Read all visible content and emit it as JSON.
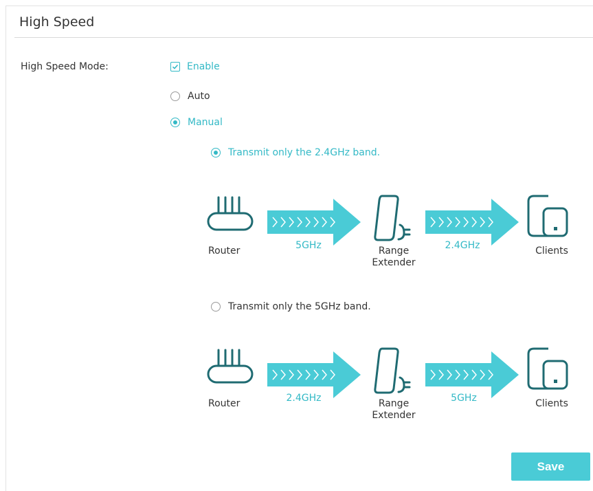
{
  "section": {
    "title": "High Speed"
  },
  "mode": {
    "label": "High Speed Mode:",
    "enable_label": "Enable",
    "enabled": true,
    "auto_label": "Auto",
    "manual_label": "Manual",
    "selected": "Manual"
  },
  "bands": [
    {
      "option_label": "Transmit only the 2.4GHz band.",
      "selected": true,
      "router_label": "Router",
      "link1_label": "5GHz",
      "extender_label_line1": "Range",
      "extender_label_line2": "Extender",
      "link2_label": "2.4GHz",
      "clients_label": "Clients"
    },
    {
      "option_label": "Transmit only the 5GHz band.",
      "selected": false,
      "router_label": "Router",
      "link1_label": "2.4GHz",
      "extender_label_line1": "Range",
      "extender_label_line2": "Extender",
      "link2_label": "5GHz",
      "clients_label": "Clients"
    }
  ],
  "actions": {
    "save_label": "Save"
  },
  "colors": {
    "accent": "#33b9c6",
    "icon": "#1f6b72",
    "button": "#4acbd6"
  }
}
